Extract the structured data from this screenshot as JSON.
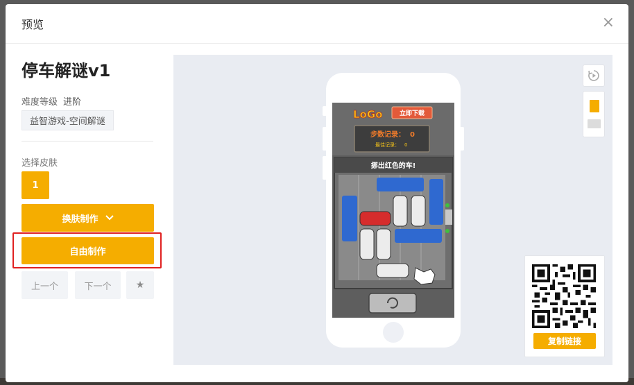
{
  "modal": {
    "title": "预览",
    "close_symbol": "×"
  },
  "game": {
    "name": "停车解谜v1",
    "difficulty_label": "难度等级",
    "difficulty_value": "进阶",
    "tag": "益智游戏-空间解谜"
  },
  "skin": {
    "label": "选择皮肤",
    "options": [
      "1"
    ],
    "selected": "1"
  },
  "actions": {
    "reskin": "换肤制作",
    "free_make": "自由制作",
    "prev": "上一个",
    "next": "下一个",
    "star_symbol": "★"
  },
  "game_screen": {
    "logo": "LoGo",
    "download": "立即下载",
    "steps_label": "步数记录：",
    "steps_value": "0",
    "best_label": "最佳记录：",
    "best_value": "0",
    "instruction": "挪出红色的车!"
  },
  "qr": {
    "copy_link": "复制链接"
  },
  "colors": {
    "accent": "#f5ad00",
    "highlight": "#e02020"
  }
}
